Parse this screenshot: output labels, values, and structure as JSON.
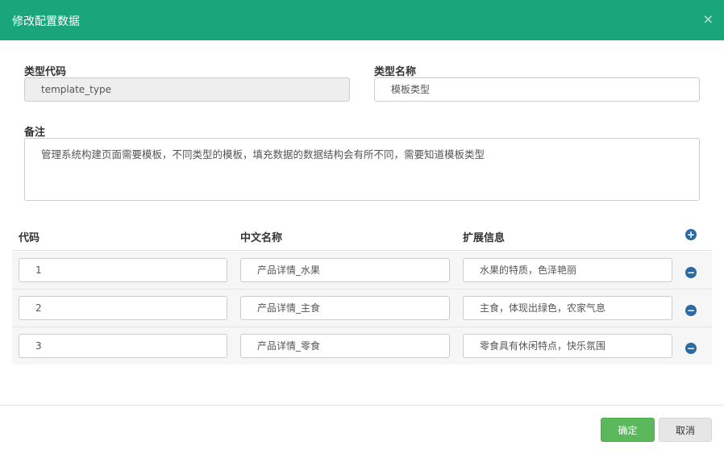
{
  "dialog": {
    "title": "修改配置数据",
    "close_symbol": "×"
  },
  "form": {
    "type_code": {
      "label": "类型代码",
      "value": "template_type"
    },
    "type_name": {
      "label": "类型名称",
      "value": "模板类型"
    },
    "remark": {
      "label": "备注",
      "value": "管理系统构建页面需要模板，不同类型的模板，填充数据的数据结构会有所不同，需要知道模板类型"
    }
  },
  "table": {
    "headers": {
      "code": "代码",
      "cn_name": "中文名称",
      "ext_info": "扩展信息"
    },
    "rows": [
      {
        "code": "1",
        "cn_name": "产品详情_水果",
        "ext_info": "水果的特质，色泽艳丽"
      },
      {
        "code": "2",
        "cn_name": "产品详情_主食",
        "ext_info": "主食，体现出绿色，农家气息"
      },
      {
        "code": "3",
        "cn_name": "产品详情_零食",
        "ext_info": "零食具有休闲特点，快乐氛围"
      }
    ],
    "add_symbol": "+",
    "remove_symbol": "−"
  },
  "footer": {
    "ok_label": "确定",
    "cancel_label": "取消"
  },
  "colors": {
    "header_bg": "#1aa57a",
    "ok_button": "#5cb85c",
    "row_action_icon": "#2d6a9f"
  }
}
